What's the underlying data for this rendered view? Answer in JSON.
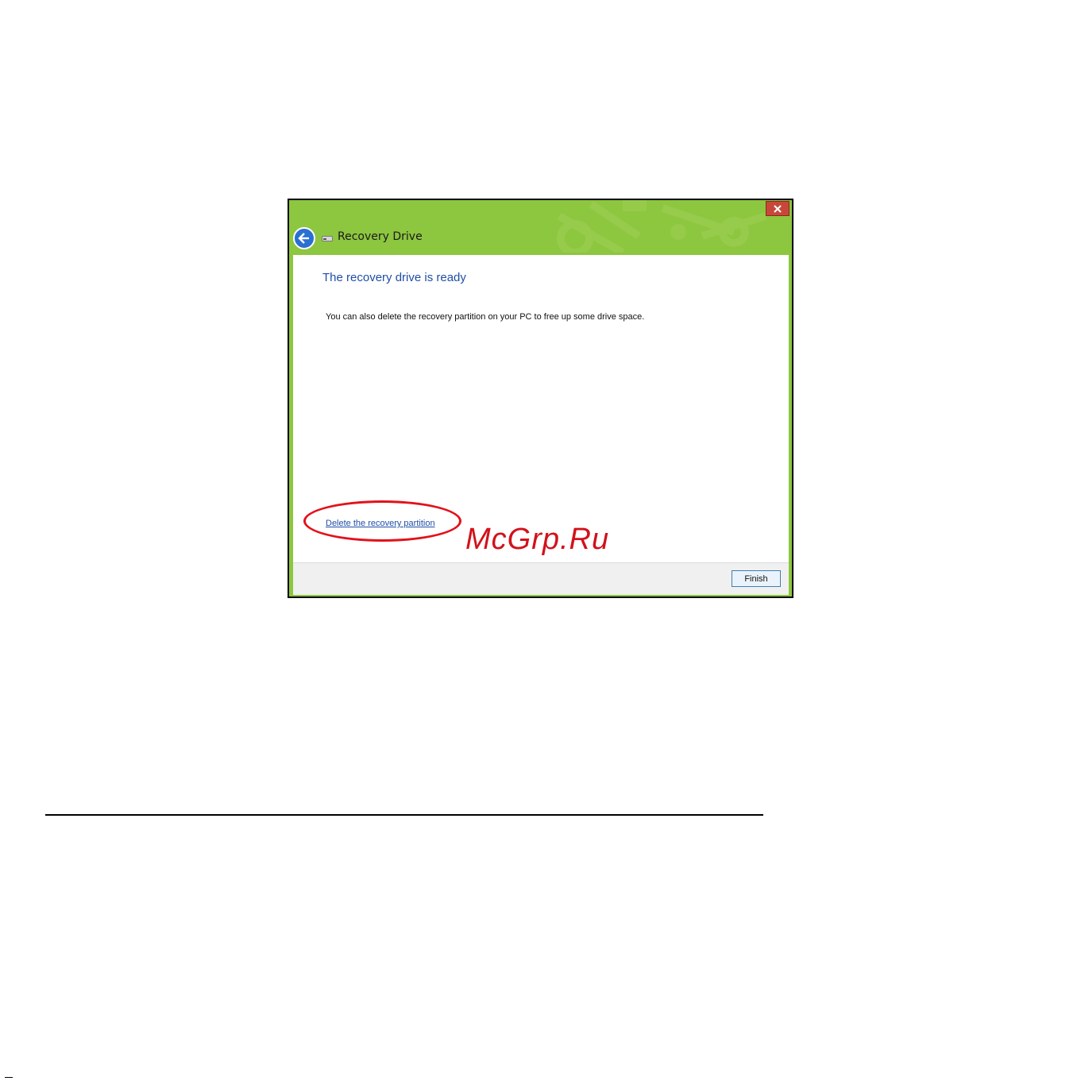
{
  "window": {
    "title": "Recovery Drive",
    "close_symbol": "✕",
    "back_icon": "back-arrow-icon",
    "drive_icon": "usb-drive-icon"
  },
  "content": {
    "heading": "The recovery drive is ready",
    "message": "You can also delete the recovery partition on your PC to free up some drive space.",
    "link_label": "Delete the recovery partition"
  },
  "footer": {
    "finish_label": "Finish"
  },
  "watermark": "McGrp.Ru",
  "colors": {
    "titlebar_green": "#8dc63f",
    "heading_blue": "#1f4ea8",
    "highlight_red": "#e3111a"
  }
}
